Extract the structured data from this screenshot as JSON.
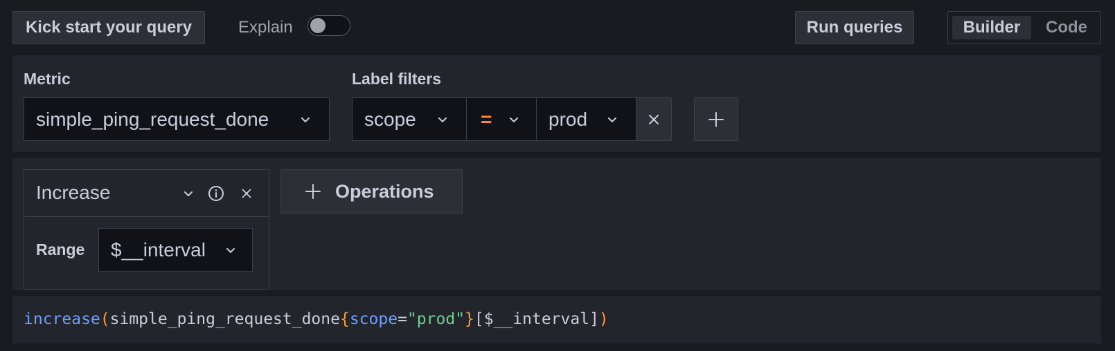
{
  "toolbar": {
    "kick_start_label": "Kick start your query",
    "explain_label": "Explain",
    "explain_enabled": false,
    "run_queries_label": "Run queries",
    "mode_builder_label": "Builder",
    "mode_code_label": "Code",
    "active_mode": "Builder"
  },
  "metric_section": {
    "metric_heading": "Metric",
    "metric_value": "simple_ping_request_done",
    "label_filters_heading": "Label filters",
    "filter": {
      "label": "scope",
      "operator": "=",
      "value": "prod"
    }
  },
  "operations": {
    "operation": {
      "name": "Increase",
      "range_label": "Range",
      "range_value": "$__interval"
    },
    "add_operations_label": "Operations"
  },
  "query_preview": {
    "func": "increase",
    "open_paren": "(",
    "metric": "simple_ping_request_done",
    "open_brace": "{",
    "label_key": "scope",
    "equals": "=",
    "label_value": "\"prod\"",
    "close_brace": "}",
    "range": "[$__interval]",
    "close_paren": ")"
  },
  "colors": {
    "background": "#181b1f",
    "panel": "#22252b",
    "input_bg": "#111217",
    "operator_orange": "#ff8833",
    "code_function_blue": "#6e9fff",
    "code_string_green": "#6ccf8e",
    "code_paren_orange": "#ff9830"
  },
  "icons": {
    "chevron": "chevron-down-icon",
    "remove": "close-icon",
    "add": "plus-icon",
    "info": "info-circle-icon"
  }
}
